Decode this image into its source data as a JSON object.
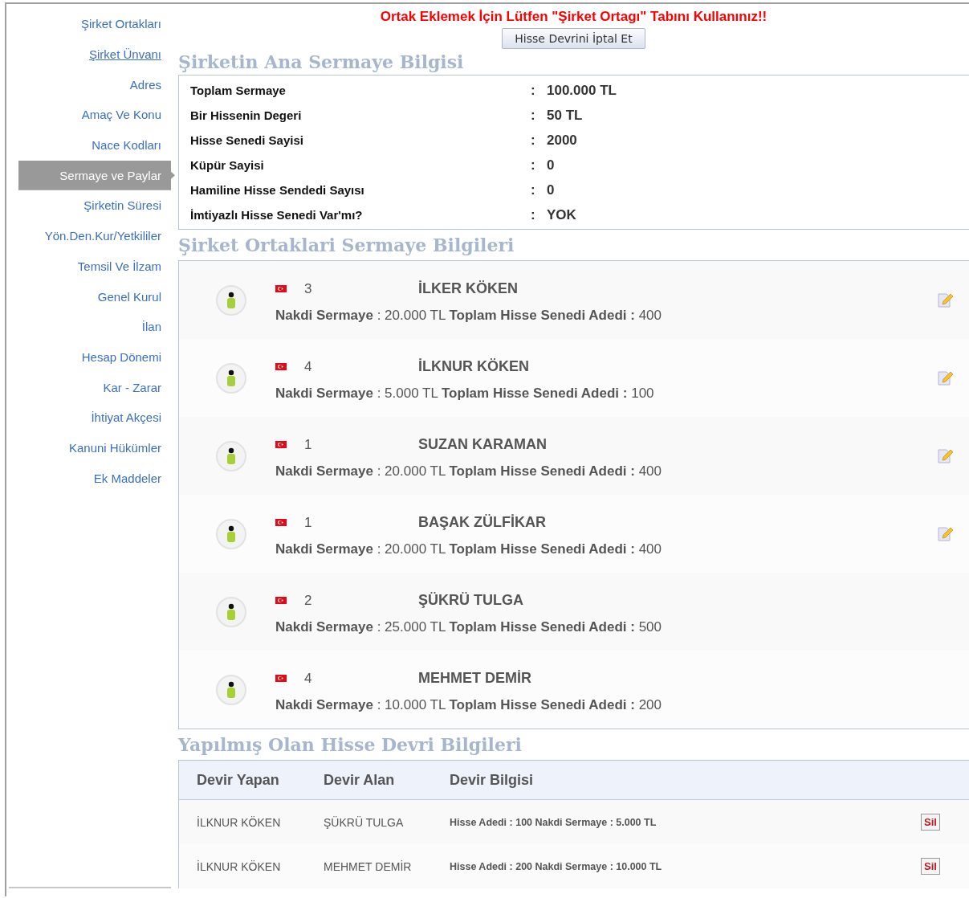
{
  "sidebar": {
    "items": [
      {
        "label": "Şirket Ortakları",
        "selected": false,
        "underlined": false
      },
      {
        "label": "Şirket Ünvanı",
        "selected": false,
        "underlined": true
      },
      {
        "label": "Adres",
        "selected": false,
        "underlined": false
      },
      {
        "label": "Amaç Ve Konu",
        "selected": false,
        "underlined": false
      },
      {
        "label": "Nace Kodları",
        "selected": false,
        "underlined": false
      },
      {
        "label": "Sermaye ve Paylar",
        "selected": true,
        "underlined": false
      },
      {
        "label": "Şirketin Süresi",
        "selected": false,
        "underlined": false
      },
      {
        "label": "Yön.Den.Kur/Yetkililer",
        "selected": false,
        "underlined": false
      },
      {
        "label": "Temsil Ve İlzam",
        "selected": false,
        "underlined": false
      },
      {
        "label": "Genel Kurul",
        "selected": false,
        "underlined": false
      },
      {
        "label": "İlan",
        "selected": false,
        "underlined": false
      },
      {
        "label": "Hesap Dönemi",
        "selected": false,
        "underlined": false
      },
      {
        "label": "Kar - Zarar",
        "selected": false,
        "underlined": false
      },
      {
        "label": "İhtiyat Akçesi",
        "selected": false,
        "underlined": false
      },
      {
        "label": "Kanuni Hükümler",
        "selected": false,
        "underlined": false
      },
      {
        "label": "Ek Maddeler",
        "selected": false,
        "underlined": false
      }
    ]
  },
  "warning": "Ortak Eklemek İçin Lütfen \"Şirket Ortagı\" Tabını Kullanınız!!",
  "cancel_button": "Hisse Devrini İptal Et",
  "capital": {
    "title": "Şirketin Ana Sermaye Bilgisi",
    "rows": [
      {
        "label": "Toplam Sermaye",
        "separator": ":",
        "value": "100.000 TL"
      },
      {
        "label": "Bir Hissenin Degeri",
        "separator": ":",
        "value": "50 TL"
      },
      {
        "label": "Hisse Senedi Sayisi",
        "separator": ":",
        "value": "2000"
      },
      {
        "label": "Küpür Sayisi",
        "separator": ":",
        "value": "0"
      },
      {
        "label": "Hamiline Hisse Sendedi Sayısı",
        "separator": ":",
        "value": "0"
      },
      {
        "label": "İmtiyazlı Hisse Senedi Var'mı?",
        "separator": ":",
        "value": "YOK"
      }
    ]
  },
  "partners": {
    "title": "Şirket Ortaklari Sermaye Bilgileri",
    "items": [
      {
        "id": "3",
        "name": "İLKER KÖKEN",
        "capital_label": "Nakdi Sermaye",
        "capital": ": 20.000 TL",
        "shares_label": "Toplam Hisse Senedi Adedi :",
        "shares": "400",
        "editable": true
      },
      {
        "id": "4",
        "name": "İLKNUR KÖKEN",
        "capital_label": "Nakdi Sermaye",
        "capital": ": 5.000 TL",
        "shares_label": "Toplam Hisse Senedi Adedi :",
        "shares": "100",
        "editable": true
      },
      {
        "id": "1",
        "name": "SUZAN KARAMAN",
        "capital_label": "Nakdi Sermaye",
        "capital": ": 20.000 TL",
        "shares_label": "Toplam Hisse Senedi Adedi :",
        "shares": "400",
        "editable": true
      },
      {
        "id": "1",
        "name": "BAŞAK ZÜLFİKAR",
        "capital_label": "Nakdi Sermaye",
        "capital": ": 20.000 TL",
        "shares_label": "Toplam Hisse Senedi Adedi :",
        "shares": "400",
        "editable": true
      },
      {
        "id": "2",
        "name": "ŞÜKRÜ TULGA",
        "capital_label": "Nakdi Sermaye",
        "capital": ": 25.000 TL",
        "shares_label": "Toplam Hisse Senedi Adedi :",
        "shares": "500",
        "editable": false
      },
      {
        "id": "4",
        "name": "MEHMET DEMİR",
        "capital_label": "Nakdi Sermaye",
        "capital": ": 10.000 TL",
        "shares_label": "Toplam Hisse Senedi Adedi :",
        "shares": "200",
        "editable": false
      }
    ]
  },
  "transfers": {
    "title": "Yapılmış Olan Hisse Devri Bilgileri",
    "columns": [
      "Devir Yapan",
      "Devir Alan",
      "Devir Bilgisi"
    ],
    "rows": [
      {
        "from": "İLKNUR KÖKEN",
        "to": "ŞÜKRÜ TULGA",
        "info": "Hisse Adedi : 100 Nakdi Sermaye : 5.000 TL",
        "delete": "Sil"
      },
      {
        "from": "İLKNUR KÖKEN",
        "to": "MEHMET DEMİR",
        "info": "Hisse Adedi : 200 Nakdi Sermaye : 10.000 TL",
        "delete": "Sil"
      }
    ]
  }
}
